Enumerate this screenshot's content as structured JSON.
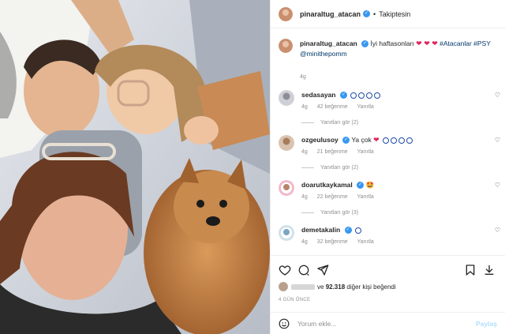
{
  "post": {
    "username": "pinaraltug_atacan",
    "follow_status": "Takiptesin"
  },
  "caption": {
    "username": "pinaraltug_atacan",
    "text": "İyi haftasonları",
    "hearts": "❤ ❤ ❤",
    "hashtags": "#Atacanlar #PSY",
    "mention": "@minithepomm",
    "time": "4g"
  },
  "comments": [
    {
      "username": "sedasayan",
      "text": "",
      "emoji_count": 4,
      "time": "4g",
      "likes": "42 beğenme",
      "reply": "Yanıtla",
      "view_replies": "Yanıtları gör (2)"
    },
    {
      "username": "ozgeulusoy",
      "text": "Ya çok",
      "heart": "❤",
      "emoji_count": 4,
      "time": "4g",
      "likes": "21 beğenme",
      "reply": "Yanıtla",
      "view_replies": "Yanıtları gör (2)"
    },
    {
      "username": "doarutkaykamal",
      "text": "",
      "face": "🤩",
      "time": "4g",
      "likes": "22 beğenme",
      "reply": "Yanıtla",
      "view_replies": "Yanıtları gör (3)"
    },
    {
      "username": "demetakalin",
      "text": "",
      "emoji_count": 1,
      "time": "4g",
      "likes": "32 beğenme",
      "reply": "Yanıtla"
    }
  ],
  "likes_line": {
    "count": "92.318",
    "suffix": "diğer kişi beğendi",
    "prefix_name": "ve"
  },
  "date": "4 GÜN ÖNCE",
  "add_comment": {
    "placeholder": "Yorum ekle...",
    "post_label": "Paylaş"
  },
  "colors": {
    "link": "#00376b",
    "verified": "#3897f0",
    "emoji_ring": "#1f4aa8",
    "post_disabled": "#b2dffc"
  },
  "icons": [
    "heart-icon",
    "comment-icon",
    "share-icon",
    "bookmark-icon",
    "download-icon",
    "emoji-icon",
    "like-comment-icon"
  ]
}
